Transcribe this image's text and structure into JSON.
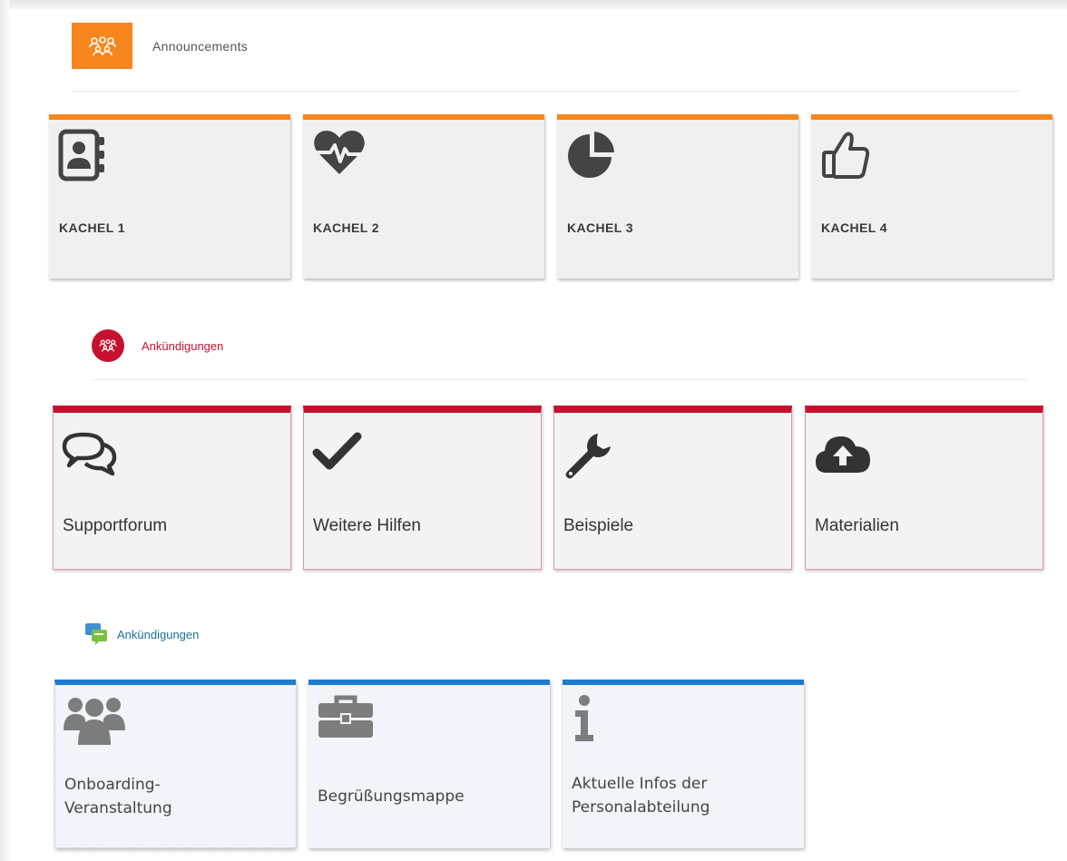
{
  "sections": [
    {
      "title": "Announcements",
      "accent": "#f7861f",
      "header_icon": "group-icon",
      "tiles": [
        {
          "label": "KACHEL 1",
          "icon": "contact-book-icon"
        },
        {
          "label": "KACHEL 2",
          "icon": "heartbeat-icon"
        },
        {
          "label": "KACHEL 3",
          "icon": "pie-chart-icon"
        },
        {
          "label": "KACHEL 4",
          "icon": "thumbs-up-icon"
        }
      ]
    },
    {
      "title": "Ankündigungen",
      "accent": "#c8102e",
      "header_icon": "group-icon",
      "tiles": [
        {
          "label": "Supportforum",
          "icon": "chat-bubbles-icon"
        },
        {
          "label": "Weitere Hilfen",
          "icon": "checkmark-icon"
        },
        {
          "label": "Beispiele",
          "icon": "wrench-icon"
        },
        {
          "label": "Materialien",
          "icon": "cloud-upload-icon"
        }
      ]
    },
    {
      "title": "Ankündigungen",
      "accent": "#1e7bd0",
      "header_icon": "chat-icon",
      "tiles": [
        {
          "label_lines": [
            "Onboarding-",
            "Veranstaltung"
          ],
          "icon": "users-icon"
        },
        {
          "label_lines": [
            "Begrüßungsmappe"
          ],
          "icon": "briefcase-icon"
        },
        {
          "label_lines": [
            "Aktuelle Infos der",
            "Personalabteilung"
          ],
          "icon": "info-icon"
        }
      ]
    }
  ]
}
